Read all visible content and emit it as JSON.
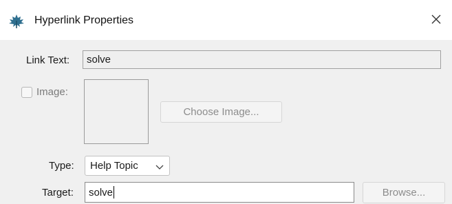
{
  "window": {
    "title": "Hyperlink Properties",
    "icon": "maple-leaf-icon",
    "close_icon": "close-icon"
  },
  "link_text": {
    "label": "Link Text:",
    "value": "solve"
  },
  "image": {
    "checkbox_label": "Image:",
    "checked": false,
    "choose_button": "Choose Image..."
  },
  "type": {
    "label": "Type:",
    "selected": "Help Topic"
  },
  "target": {
    "label": "Target:",
    "value": "solve",
    "browse_button": "Browse..."
  }
}
